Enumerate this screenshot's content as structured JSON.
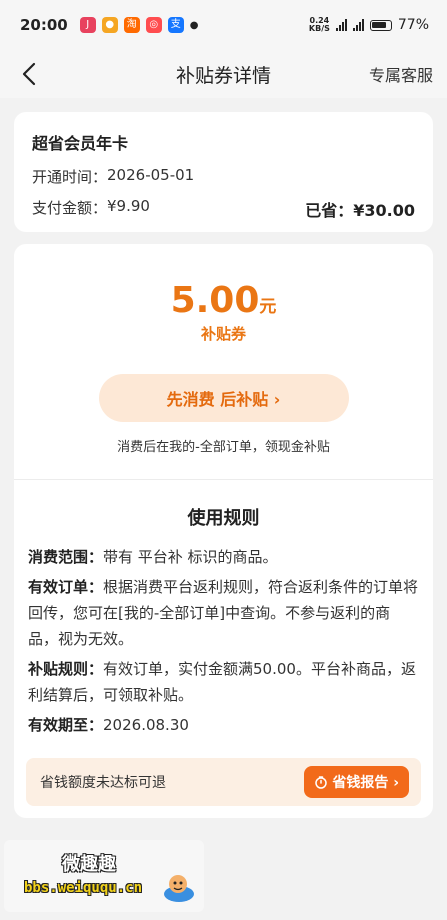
{
  "status": {
    "time": "20:00",
    "net_speed_top": "0.24",
    "net_speed_bottom": "KB/S",
    "battery": "77%",
    "app_icons": [
      "jd-app",
      "goldfish-app",
      "taobao-app",
      "map-app",
      "alipay-app"
    ]
  },
  "nav": {
    "title": "补贴券详情",
    "service": "专属客服"
  },
  "membership": {
    "title": "超省会员年卡",
    "open_time_label": "开通时间：",
    "open_time": "2026-05-01",
    "pay_label": "支付金额：",
    "pay_amount": "¥9.90",
    "saved_label": "已省：",
    "saved_amount": "¥30.00"
  },
  "coupon": {
    "amount": "5.00",
    "unit": "元",
    "label": "补贴券",
    "cta": "先消费 后补贴 ›",
    "hint": "消费后在我的-全部订单，领现金补贴"
  },
  "rules": {
    "title": "使用规则",
    "items": [
      {
        "key": "消费范围：",
        "text": "带有 平台补 标识的商品。"
      },
      {
        "key": "有效订单：",
        "text": "根据消费平台返利规则，符合返利条件的订单将回传，您可在[我的-全部订单]中查询。不参与返利的商品，视为无效。"
      },
      {
        "key": "补贴规则：",
        "text": "有效订单，实付金额满50.00。平台补商品，返利结算后，可领取补贴。"
      },
      {
        "key": "有效期至：",
        "text": "2026.08.30"
      }
    ]
  },
  "bottom": {
    "text": "省钱额度未达标可退",
    "button": "省钱报告 ›"
  },
  "watermark": {
    "title": "微趣趣",
    "url": "bbs.weiququ.cn"
  },
  "colors": {
    "accent": "#ea7614",
    "button": "#f26a1a",
    "cta_bg": "#fde8d6"
  }
}
